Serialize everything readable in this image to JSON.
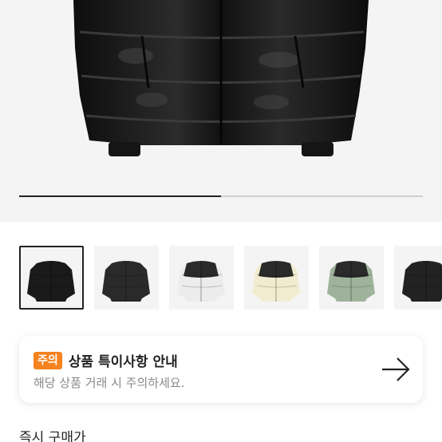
{
  "gallery": {
    "progress_fraction": 0.5
  },
  "thumbnails": [
    {
      "name": "black-glossy",
      "body": "#1a1a1a",
      "yoke": "#1a1a1a",
      "active": true
    },
    {
      "name": "black-matte",
      "body": "#2a2a2a",
      "yoke": "#2a2a2a",
      "active": false
    },
    {
      "name": "white-black",
      "body": "#ececec",
      "yoke": "#2a2a2a",
      "active": false
    },
    {
      "name": "cream-black",
      "body": "#f1eccf",
      "yoke": "#2a2a2a",
      "active": false
    },
    {
      "name": "sage-black",
      "body": "#9fb39c",
      "yoke": "#2a2a2a",
      "active": false
    },
    {
      "name": "black-partial",
      "body": "#222222",
      "yoke": "#222222",
      "active": false
    }
  ],
  "notice": {
    "badge": "주의",
    "title": "상품 특이사항 안내",
    "subtitle": "해당 상품 거래 시 주의하세요.",
    "arrow_icon": "arrow-right-icon"
  },
  "price": {
    "label": "즉시 구매가"
  },
  "colors": {
    "badge": "#f6821f"
  }
}
